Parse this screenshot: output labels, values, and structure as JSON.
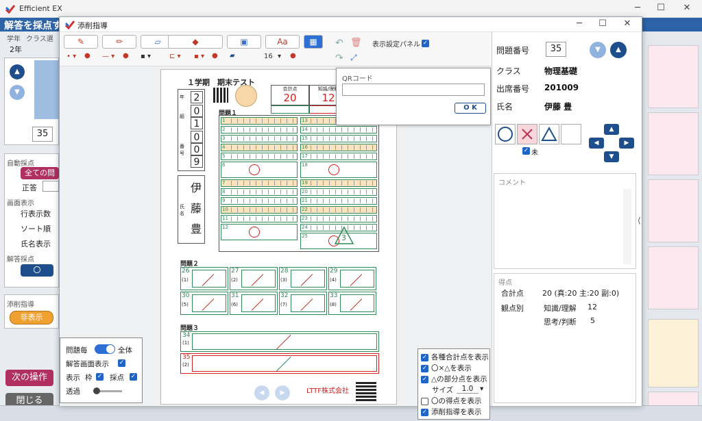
{
  "main": {
    "app_title": "Efficient EX",
    "header_text": "解答を採点す",
    "left": {
      "grade_label": "学年",
      "class_label": "クラス選",
      "grade_value": "2年",
      "page_number": "35",
      "auto_grading_label": "自動採点",
      "all_button": "全ての問",
      "correct_label": "正答",
      "screen_display_label": "画面表示",
      "rows_label": "行表示数",
      "sort_label": "ソート順",
      "name_display_label": "氏名表示",
      "answer_grading_label": "解答採点",
      "answer_circle": "〇",
      "correction_label": "添削指導",
      "hide_button": "非表示",
      "next_op_button": "次の操作",
      "close_button": "閉じる"
    }
  },
  "dialog": {
    "title": "添削指導",
    "toolbar": {
      "font_button": "Aa",
      "font_size": "16",
      "display_panel_label": "表示設定パネル"
    },
    "qr_popup": {
      "title": "QRコード",
      "input_value": "",
      "ok_label": "O K"
    },
    "sheet": {
      "title": "１学期　期末テスト",
      "total_label": "合計点",
      "knowledge_label": "知識/理解",
      "total_score": "20",
      "knowledge_score": "12",
      "q1_label": "問題１",
      "q2_label": "問題２",
      "q3_label": "問題３",
      "grade_tag": "年",
      "class_tag": "組",
      "number_tag": "番号",
      "name_tag": "氏名",
      "grade_digit": "2",
      "class_digits": [
        "0",
        "1"
      ],
      "number_digits": [
        "0",
        "0",
        "9"
      ],
      "name_chars": [
        "伊",
        "藤",
        "豊"
      ],
      "company": "LTTF株式会社",
      "q1_left": [
        "1",
        "2",
        "3",
        "4",
        "5",
        "6",
        "7",
        "8",
        "9",
        "10",
        "11",
        "12"
      ],
      "q1_right": [
        "13",
        "14",
        "15",
        "16",
        "17",
        "18",
        "19",
        "20",
        "21",
        "22",
        "23",
        "24",
        "25"
      ],
      "q2": [
        {
          "num": "26",
          "sub": "(1)"
        },
        {
          "num": "27",
          "sub": "(2)"
        },
        {
          "num": "28",
          "sub": "(3)"
        },
        {
          "num": "29",
          "sub": "(4)"
        },
        {
          "num": "30",
          "sub": "(5)"
        },
        {
          "num": "31",
          "sub": "(6)"
        },
        {
          "num": "32",
          "sub": "(7)"
        },
        {
          "num": "33",
          "sub": "(8)"
        }
      ],
      "q3": [
        {
          "num": "34",
          "sub": "(1)"
        },
        {
          "num": "35",
          "sub": "(2)"
        }
      ],
      "triangle_score": "3"
    },
    "right_panel": {
      "question_number_label": "問題番号",
      "question_number": "35",
      "class_label": "クラス",
      "class_value": "物理基礎",
      "attendance_label": "出席番号",
      "attendance_value": "201009",
      "name_label": "氏名",
      "name_value": "伊藤 豊",
      "unmarked_label": "未",
      "comment_label": "コメント",
      "score_label": "得点",
      "total_label": "合計点",
      "total_value": "20 (真:20 主:20 副:0)",
      "perspective_label": "観点別",
      "perspectives": [
        {
          "name": "知識/理解",
          "value": "12"
        },
        {
          "name": "思考/判断",
          "value": "5"
        }
      ]
    },
    "options_panel": {
      "per_question": "問題毎",
      "all": "全体",
      "answer_screen": "解答画面表示",
      "display": "表示",
      "frame": "枠",
      "grading": "採点",
      "transparency": "透過"
    },
    "display_panel": {
      "items": [
        "各種合計点を表示",
        "〇×△を表示",
        "△の部分点を表示"
      ],
      "size_label": "サイズ",
      "size_value": "1.0",
      "items2": [
        "〇の得点を表示",
        "添削指導を表示"
      ]
    }
  }
}
